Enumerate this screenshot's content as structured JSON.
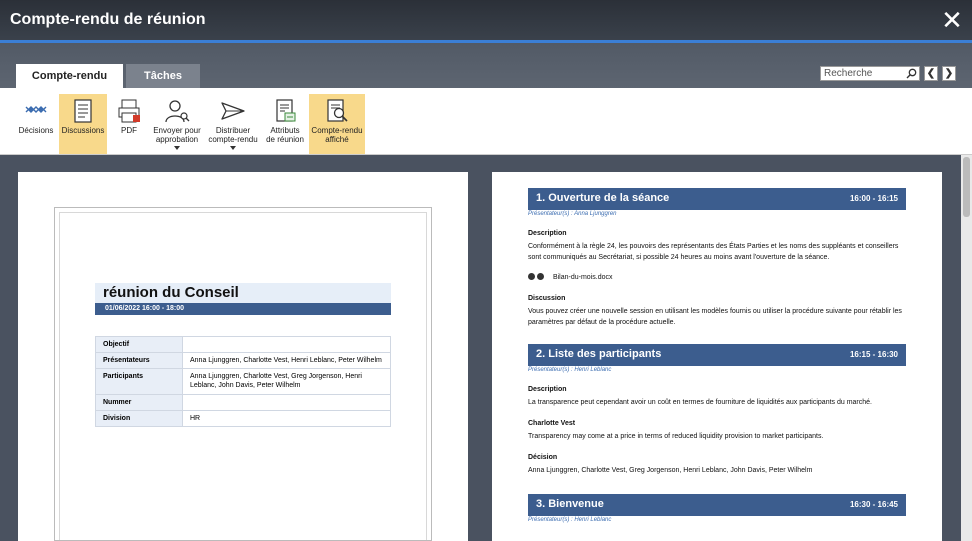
{
  "window": {
    "title": "Compte-rendu de réunion",
    "close_glyph": "✕"
  },
  "tabs": [
    {
      "label": "Compte-rendu"
    },
    {
      "label": "Tâches"
    }
  ],
  "search": {
    "placeholder": "Recherche"
  },
  "nav": {
    "prev": "❮",
    "next": "❯"
  },
  "ribbon": {
    "items": [
      {
        "label": "Décisions",
        "icon": "decisions-icon",
        "selected": false
      },
      {
        "label": "Discussions",
        "icon": "discussions-icon",
        "selected": true
      },
      {
        "label": "PDF",
        "icon": "pdf-icon",
        "selected": false
      },
      {
        "label": "Envoyer pour approbation",
        "line1": "Envoyer pour",
        "line2": "approbation",
        "icon": "user-search-icon",
        "selected": false
      },
      {
        "label": "Distribuer compte-rendu",
        "line1": "Distribuer",
        "line2": "compte-rendu",
        "icon": "send-icon",
        "selected": false
      },
      {
        "label": "Attributs de réunion",
        "line1": "Attributs",
        "line2": "de réunion",
        "icon": "attributes-icon",
        "selected": false
      },
      {
        "label": "Compte-rendu affiché",
        "line1": "Compte-rendu",
        "line2": "affiché",
        "icon": "preview-icon",
        "selected": true
      }
    ]
  },
  "cover": {
    "title": "réunion du Conseil",
    "date": "01/06/2022 16:00 - 18:00",
    "rows": [
      {
        "key": "Objectif",
        "value": ""
      },
      {
        "key": "Présentateurs",
        "value": "Anna Ljunggren, Charlotte Vest, Henri Leblanc, Peter Wilhelm"
      },
      {
        "key": "Participants",
        "value": "Anna Ljunggren, Charlotte Vest, Greg Jorgenson, Henri Leblanc, John Davis, Peter Wilhelm"
      },
      {
        "key": "Nummer",
        "value": ""
      },
      {
        "key": "Division",
        "value": "HR"
      }
    ]
  },
  "agenda": {
    "s1": {
      "title": "1. Ouverture de la séance",
      "time": "16:00 - 16:15",
      "presenter": "Présentateur(s) : Anna Ljunggren",
      "desc_label": "Description",
      "desc_text": "Conformément à la règle 24, les pouvoirs des représentants des États Parties et les noms des suppléants et conseillers sont communiqués au Secrétariat, si possible 24 heures au moins avant l'ouverture de la séance.",
      "attachment": "Bilan-du-mois.docx",
      "disc_label": "Discussion",
      "disc_text": "Vous pouvez créer une nouvelle session en utilisant les modèles fournis ou utiliser la procédure suivante pour rétablir les paramètres par défaut de la procédure actuelle."
    },
    "s2": {
      "title": "2. Liste des participants",
      "time": "16:15 - 16:30",
      "presenter": "Présentateur(s) : Henri Leblanc",
      "desc_label": "Description",
      "desc_text": "La transparence peut cependant avoir un coût en termes de fourniture de liquidités aux participants du marché.",
      "cv_label": "Charlotte Vest",
      "cv_text": "Transparency may come at a price in terms of reduced liquidity provision to market participants.",
      "dec_label": "Décision",
      "dec_text": "Anna Ljunggren, Charlotte Vest, Greg Jorgenson, Henri Leblanc, John Davis, Peter Wilhelm"
    },
    "s3": {
      "title": "3. Bienvenue",
      "time": "16:30 - 16:45",
      "presenter": "Présentateur(s) : Henri Leblanc"
    }
  },
  "colors": {
    "accent": "#3b7fd6",
    "section_header": "#3c5d8e",
    "ribbon_selected": "#f8d98b"
  }
}
